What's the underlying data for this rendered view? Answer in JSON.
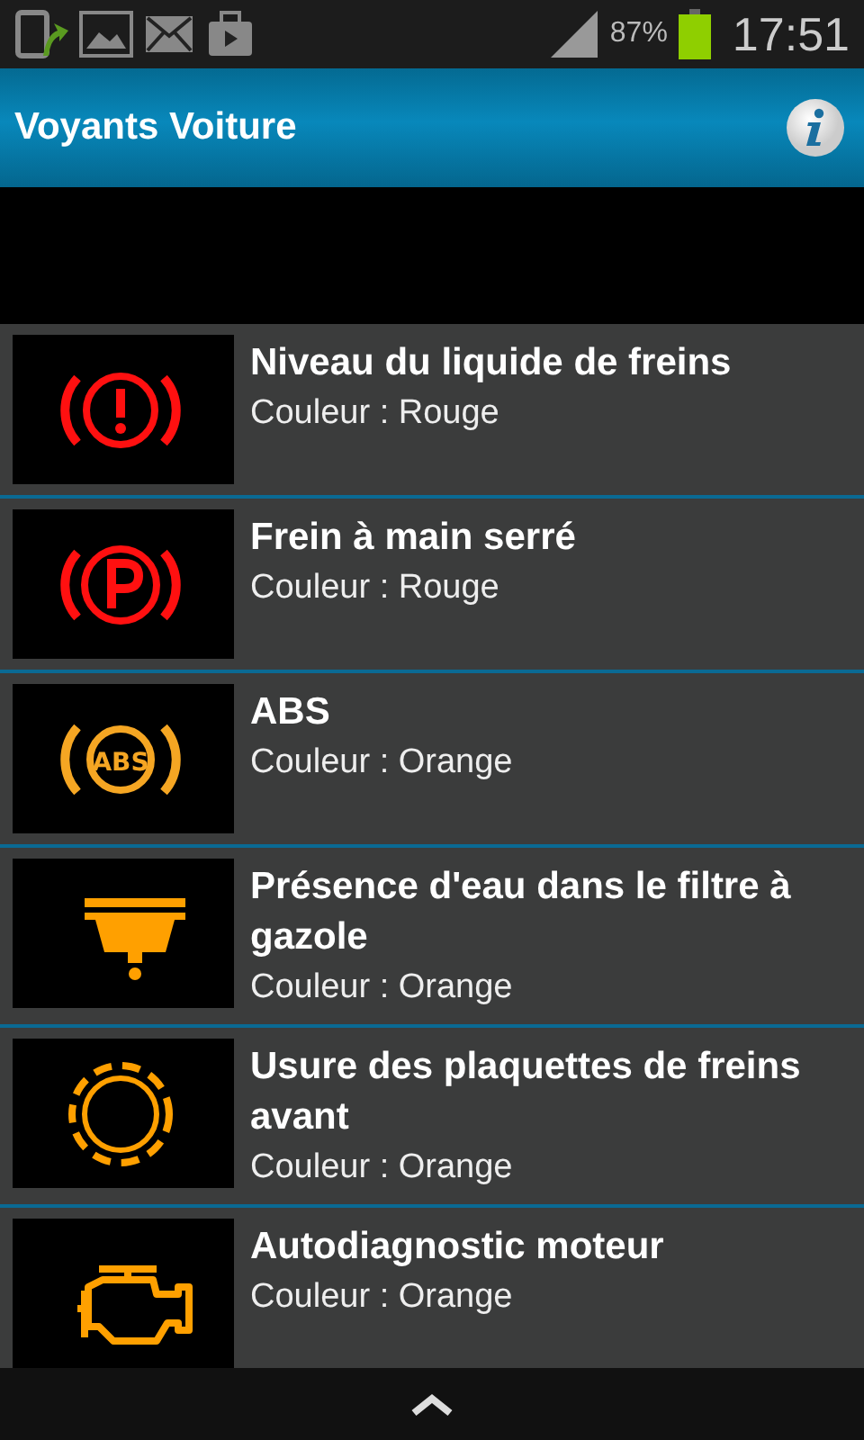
{
  "status_bar": {
    "battery": "87%",
    "time": "17:51"
  },
  "header": {
    "title": "Voyants Voiture"
  },
  "lights": [
    {
      "title": "Niveau du liquide de freins",
      "subtitle": "Couleur : Rouge",
      "kind": "brake-fluid",
      "color": "#ff1010"
    },
    {
      "title": "Frein à main serré",
      "subtitle": "Couleur : Rouge",
      "kind": "parking-brake",
      "color": "#ff1010"
    },
    {
      "title": "ABS",
      "subtitle": "Couleur : Orange",
      "kind": "abs",
      "icon_label": "ABS",
      "color": "#f5a623"
    },
    {
      "title": "Présence d'eau dans le filtre à gazole",
      "subtitle": "Couleur : Orange",
      "kind": "water-filter",
      "color": "#ffa000"
    },
    {
      "title": "Usure des plaquettes de freins avant",
      "subtitle": "Couleur : Orange",
      "kind": "brake-pads",
      "color": "#ffa000"
    },
    {
      "title": "Autodiagnostic moteur",
      "subtitle": "Couleur : Orange",
      "kind": "engine",
      "color": "#ffa000"
    }
  ]
}
